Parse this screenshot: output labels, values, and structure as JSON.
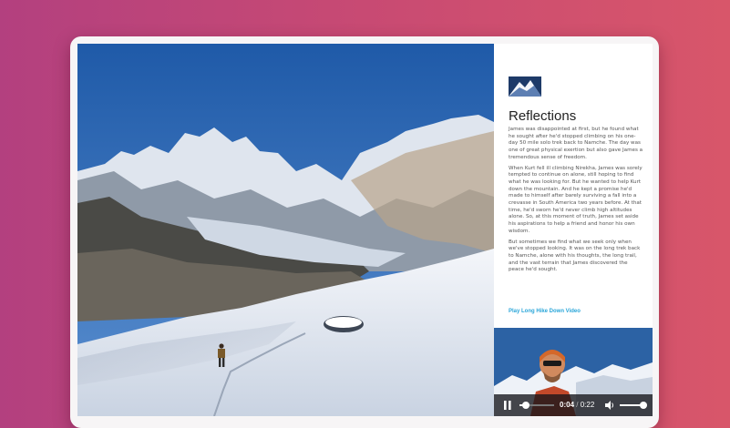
{
  "article": {
    "title": "Reflections",
    "paragraphs": [
      "James was disappointed at first, but he found what he sought after he'd stopped climbing on his one-day 50 mile solo trek back to Namche. The day was one of great physical exertion but also gave James a tremendous sense of freedom.",
      "When Kurt fell ill climbing Nirekha, James was sorely tempted to continue on alone, still hoping to find what he was looking for. But he wanted to help Kurt down the mountain. And he kept a promise he'd made to himself after barely surviving a fall into a crevasse in South America two years before. At that time, he'd sworn he'd never climb high altitudes alone. So, at this moment of truth, James set aside his aspirations to help a friend and honor his own wisdom.",
      "But sometimes we find what we seek only when we've stopped looking. It was on the long trek back to Namche, alone with his thoughts, the long trail, and the vast terrain that James discovered the peace he'd sought."
    ],
    "video_link": "Play Long Hike Down Video"
  },
  "player": {
    "current_time": "0:04",
    "separator": "/",
    "duration": "0:22",
    "progress": 0.18,
    "volume": 0.85
  },
  "icons": {
    "logo": "mountain-logo-icon",
    "play_pause": "pause-icon",
    "volume": "volume-icon"
  },
  "colors": {
    "accent_link": "#2aa6d9",
    "background_gradient": [
      "#b3407f",
      "#d8566a"
    ]
  }
}
